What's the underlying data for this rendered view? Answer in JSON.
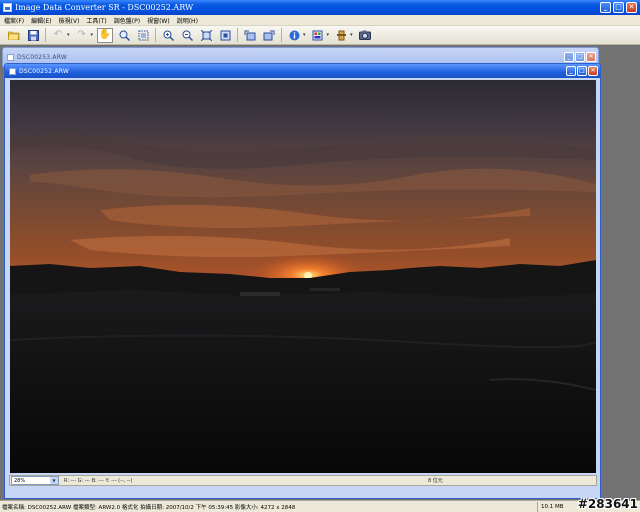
{
  "app": {
    "title": "Image Data Converter SR - DSC00252.ARW",
    "window_buttons": {
      "minimize": "_",
      "maximize": "□",
      "close": "✕"
    }
  },
  "menu": [
    {
      "label": "檔案(F)"
    },
    {
      "label": "編輯(E)"
    },
    {
      "label": "檢視(V)"
    },
    {
      "label": "工具(T)"
    },
    {
      "label": "調色盤(P)"
    },
    {
      "label": "視窗(W)"
    },
    {
      "label": "說明(H)"
    }
  ],
  "toolbar": {
    "icons": [
      "open-folder-icon",
      "save-icon",
      "undo-icon",
      "redo-icon",
      "hand-icon",
      "magnifier-icon",
      "select-icon",
      "zoom-in-icon",
      "zoom-out-icon",
      "fit-icon",
      "actual-size-icon",
      "rotate-left-icon",
      "rotate-right-icon",
      "info-icon",
      "palette-icon",
      "adjust-icon",
      "camera-icon"
    ]
  },
  "windows": {
    "back": {
      "title": "DSC00253.ARW"
    },
    "front": {
      "title": "DSC00252.ARW"
    }
  },
  "image_status": {
    "zoom": "28%",
    "pixel_readout": "R: ---  G: ---  B: ---  Y: ---    (--, --)",
    "bits": "8 位元"
  },
  "statusbar": {
    "file_info": "檔案名稱: DSC00252.ARW  檔案類型: ARW2.0 格式化  拍攝日期: 2007/10/2 下午 05:39:45  影像大小: 4272 x 2848",
    "file_size": "10.1 MB"
  },
  "watermark": "#283641"
}
